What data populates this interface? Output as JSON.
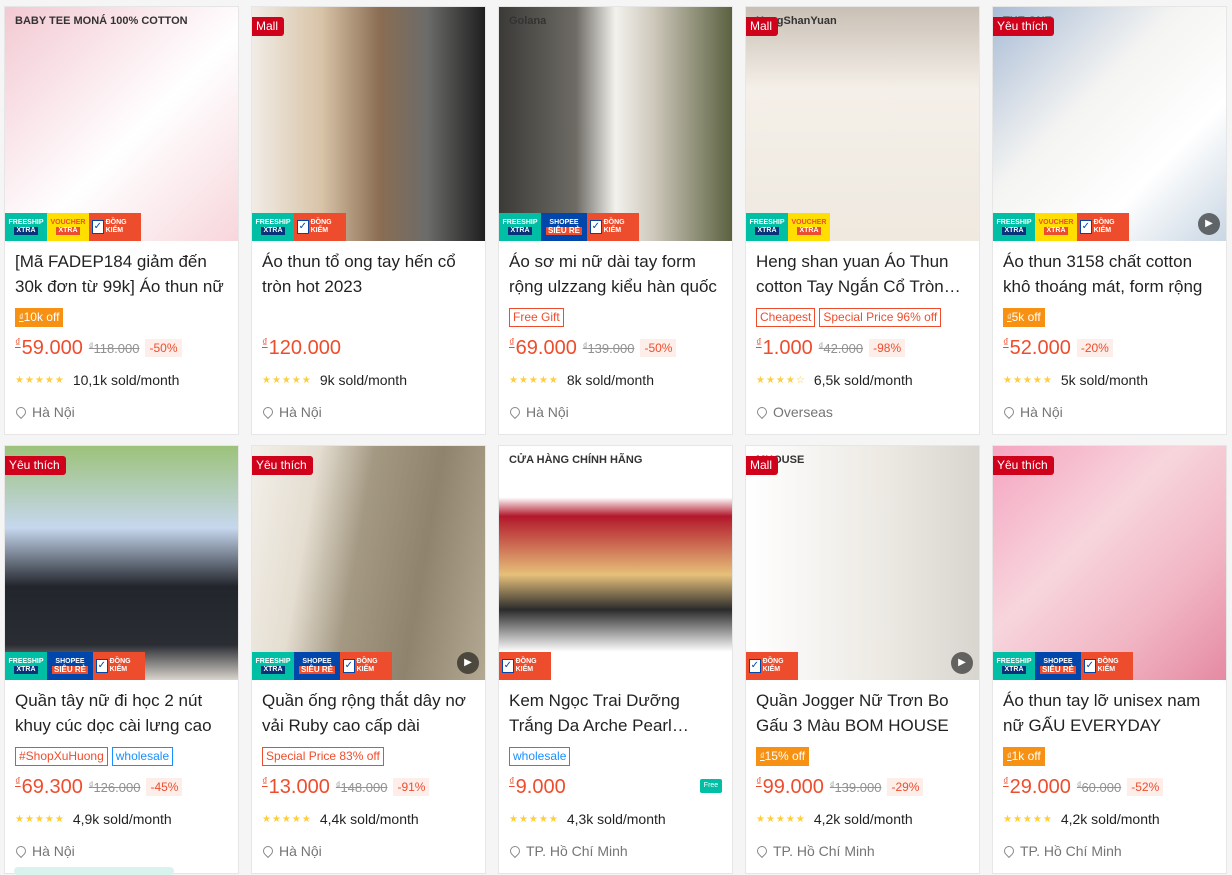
{
  "products": [
    {
      "title": "[Mã FADEP184 giảm đến 30k đơn từ 99k] Áo thun nữ",
      "corner_tag": "",
      "image_bg": "linear-gradient(135deg,#f3c9d3 0%,#ffffff 55%,#f7d6dc 100%)",
      "image_text": "BABY TEE MONÁ 100% COTTON",
      "badges": [
        "free",
        "voucher",
        "check"
      ],
      "play": false,
      "tags": [
        {
          "type": "disc",
          "text": "10k off"
        }
      ],
      "price": "59.000",
      "old_price": "118.000",
      "discount": "-50%",
      "stars": "★★★★★",
      "sold": "10,1k sold/month",
      "location": "Hà Nội",
      "free_ship": false
    },
    {
      "title": "Áo thun tổ ong tay hến cổ tròn hot 2023",
      "corner_tag": "Mall",
      "image_bg": "linear-gradient(90deg,#f1ece6 0%,#d8c3a7 30%,#8a6d53 55%,#6c6c6a 75%,#1f1f1f 100%)",
      "image_text": "",
      "badges": [
        "free",
        "check"
      ],
      "play": false,
      "tags": [],
      "price": "120.000",
      "old_price": "",
      "discount": "",
      "stars": "★★★★★",
      "sold": "9k sold/month",
      "location": "Hà Nội",
      "free_ship": false
    },
    {
      "title": "Áo sơ mi nữ dài tay form rộng ulzzang kiểu hàn quốc",
      "corner_tag": "",
      "image_bg": "linear-gradient(90deg,#3b3a37 0%,#6d6b64 33%,#f3f1ec 50%,#cfc9bd 66%,#5b6140 100%)",
      "image_text": "Golana",
      "badges": [
        "free",
        "shopee",
        "check"
      ],
      "play": false,
      "tags": [
        {
          "type": "out",
          "text": "Free Gift"
        }
      ],
      "price": "69.000",
      "old_price": "139.000",
      "discount": "-50%",
      "stars": "★★★★★",
      "sold": "8k sold/month",
      "location": "Hà Nội",
      "free_ship": false
    },
    {
      "title": "Heng shan yuan Áo Thun cotton Tay Ngắn Cổ Tròn Màu",
      "corner_tag": "Mall",
      "image_bg": "linear-gradient(180deg,#c9c0b5 0%,#f4efe8 35%,#efe9e0 100%)",
      "image_text": "HengShanYuan",
      "badges": [
        "free",
        "voucher"
      ],
      "play": false,
      "tags": [
        {
          "type": "out",
          "text": "Cheapest"
        },
        {
          "type": "out",
          "text": "Special Price 96% off"
        }
      ],
      "price": "1.000",
      "old_price": "42.000",
      "discount": "-98%",
      "stars": "★★★★☆",
      "sold": "6,5k sold/month",
      "location": "Overseas",
      "free_ship": false
    },
    {
      "title": "Áo thun 3158 chất cotton khô thoáng mát, form rộng",
      "corner_tag": "Yêu thích",
      "image_bg": "linear-gradient(135deg,#a9bcd6 0%,#f4f4f2 40%,#ffffff 70%,#c9d6e4 100%)",
      "image_text": "THE ONE",
      "badges": [
        "free",
        "voucher",
        "check"
      ],
      "play": true,
      "tags": [
        {
          "type": "disc",
          "text": "5k off"
        }
      ],
      "price": "52.000",
      "old_price": "",
      "discount": "-20%",
      "stars": "★★★★★",
      "sold": "5k sold/month",
      "location": "Hà Nội",
      "free_ship": false
    },
    {
      "title": "Quần tây nữ đi học 2 nút khuy cúc dọc cài lưng cao",
      "corner_tag": "Yêu thích",
      "image_bg": "linear-gradient(180deg,#9cc27a 0%,#c6d7ee 35%,#22252c 60%,#2a2d33 85%,#d9d4cc 100%)",
      "image_text": "",
      "badges": [
        "free",
        "shopee",
        "check"
      ],
      "play": false,
      "tags": [
        {
          "type": "out",
          "text": "#ShopXuHuong"
        },
        {
          "type": "blue",
          "text": "wholesale"
        }
      ],
      "price": "69.300",
      "old_price": "126.000",
      "discount": "-45%",
      "stars": "★★★★★",
      "sold": "4,9k sold/month",
      "location": "Hà Nội",
      "free_ship": false
    },
    {
      "title": "Quần ống rộng thắt dây nơ vải Ruby cao cấp dài",
      "corner_tag": "Yêu thích",
      "image_bg": "linear-gradient(100deg,#f3f0ea 0%,#e4ddd0 25%,#a49983 45%,#8f836d 70%,#b3a892 100%)",
      "image_text": "",
      "badges": [
        "free",
        "shopee",
        "check"
      ],
      "play": true,
      "tags": [
        {
          "type": "out",
          "text": "Special Price 83% off"
        }
      ],
      "price": "13.000",
      "old_price": "148.000",
      "discount": "-91%",
      "stars": "★★★★★",
      "sold": "4,4k sold/month",
      "location": "Hà Nội",
      "free_ship": false
    },
    {
      "title": "Kem Ngọc Trai Dưỡng Trắng Da Arche Pearl Cream",
      "corner_tag": "",
      "image_bg": "linear-gradient(180deg,#ffffff 0%,#ffffff 22%,#b2182b 30%,#e6c07a 55%,#2b2b2b 70%,#ffffff 88%)",
      "image_text": "CỬA HÀNG CHÍNH HÃNG",
      "badges": [
        "check"
      ],
      "play": false,
      "tags": [
        {
          "type": "blue",
          "text": "wholesale"
        }
      ],
      "price": "9.000",
      "old_price": "",
      "discount": "",
      "stars": "★★★★★",
      "sold": "4,3k sold/month",
      "location": "TP. Hồ Chí Minh",
      "free_ship": true
    },
    {
      "title": "Quần Jogger Nữ Trơn Bo Gấu 3 Màu BOM HOUSE",
      "corner_tag": "Mall",
      "image_bg": "linear-gradient(90deg,#ffffff 0%,#f2f0ec 40%,#ece9e3 60%,#d8d5cf 100%)",
      "image_text": "MHOUSE",
      "badges": [
        "check"
      ],
      "play": true,
      "tags": [
        {
          "type": "disc",
          "text": "15% off"
        }
      ],
      "price": "99.000",
      "old_price": "139.000",
      "discount": "-29%",
      "stars": "★★★★★",
      "sold": "4,2k sold/month",
      "location": "TP. Hồ Chí Minh",
      "free_ship": false
    },
    {
      "title": "Áo thun tay lỡ unisex nam nữ GẤU EVERYDAY",
      "corner_tag": "Yêu thích",
      "image_bg": "linear-gradient(135deg,#f6a5c0 0%,#f7d5dd 40%,#f1b6c4 70%,#e58aa3 100%)",
      "image_text": "",
      "badges": [
        "free",
        "shopee",
        "check"
      ],
      "play": false,
      "tags": [
        {
          "type": "disc",
          "text": "1k off"
        }
      ],
      "price": "29.000",
      "old_price": "60.000",
      "discount": "-52%",
      "stars": "★★★★★",
      "sold": "4,2k sold/month",
      "location": "TP. Hồ Chí Minh",
      "free_ship": false
    }
  ],
  "labels": {
    "badge_free_top": "FREESHIP",
    "badge_free_bottom": "XTRA",
    "badge_voucher_top": "VOUCHER",
    "badge_voucher_bottom": "XTRA",
    "badge_shopee_top": "SHOPEE",
    "badge_shopee_bottom": "SIÊU RẺ",
    "badge_check_text": "ĐỒNG KIỂM",
    "free_truck": "Free",
    "currency": "₫"
  }
}
